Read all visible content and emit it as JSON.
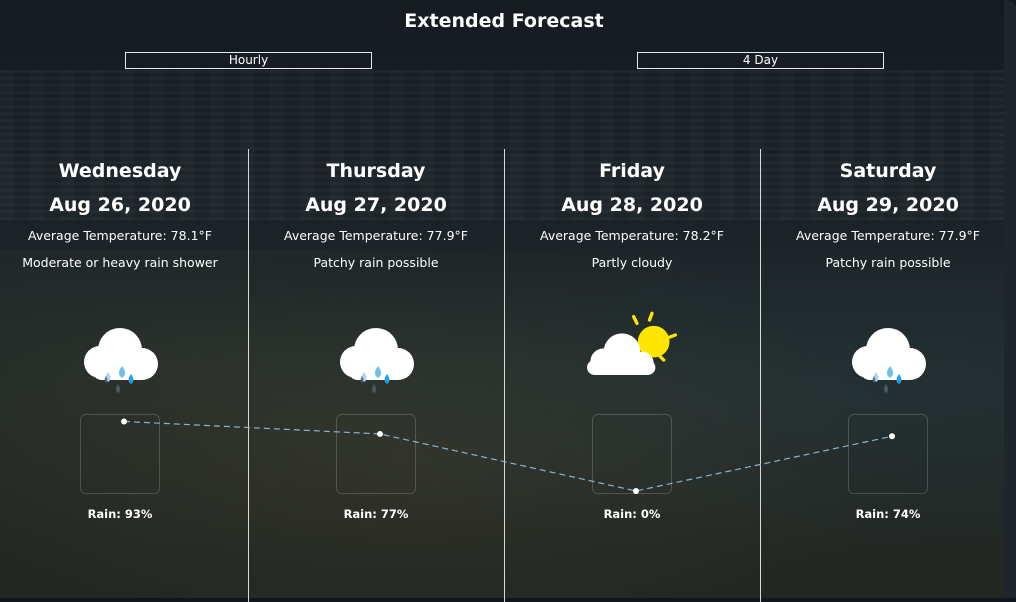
{
  "header": {
    "title": "Extended Forecast",
    "tabs": [
      {
        "label": "Hourly"
      },
      {
        "label": "4 Day"
      }
    ]
  },
  "days": [
    {
      "day": "Wednesday",
      "date": "Aug 26, 2020",
      "avg_temp": "Average Temperature: 78.1°F",
      "condition": "Moderate or heavy rain shower",
      "icon": "rain-cloud-icon",
      "rain_label": "Rain: 93%",
      "rain_chance": 93
    },
    {
      "day": "Thursday",
      "date": "Aug 27, 2020",
      "avg_temp": "Average Temperature: 77.9°F",
      "condition": "Patchy rain possible",
      "icon": "rain-cloud-icon",
      "rain_label": "Rain: 77%",
      "rain_chance": 77
    },
    {
      "day": "Friday",
      "date": "Aug 28, 2020",
      "avg_temp": "Average Temperature: 78.2°F",
      "condition": "Partly cloudy",
      "icon": "partly-cloudy-icon",
      "rain_label": "Rain: 0%",
      "rain_chance": 0
    },
    {
      "day": "Saturday",
      "date": "Aug 29, 2020",
      "avg_temp": "Average Temperature: 77.9°F",
      "condition": "Patchy rain possible",
      "icon": "rain-cloud-icon",
      "rain_label": "Rain: 74%",
      "rain_chance": 74
    }
  ],
  "colors": {
    "rain_line": "#8ab4cc",
    "sun": "#ffe600",
    "rain_drop_light": "#9fd9f5",
    "rain_drop_mid": "#6ec1ea",
    "rain_drop_dark": "#4d5a66"
  }
}
